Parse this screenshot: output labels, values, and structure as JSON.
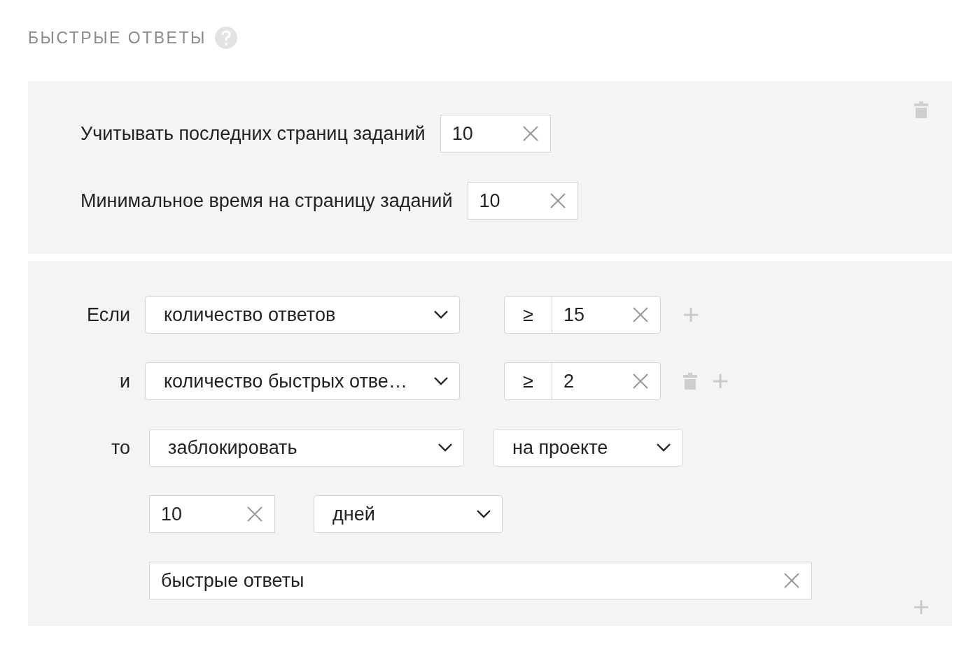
{
  "title": "БЫСТРЫЕ ОТВЕТЫ",
  "settings": [
    {
      "label": "Учитывать последних страниц заданий",
      "value": "10"
    },
    {
      "label": "Минимальное время на страницу заданий",
      "value": "10"
    }
  ],
  "conditions": [
    {
      "connector": "Если",
      "field": "количество ответов",
      "operator": "≥",
      "value": "15",
      "deletable": false
    },
    {
      "connector": "и",
      "field": "количество быстрых отве…",
      "operator": "≥",
      "value": "2",
      "deletable": true
    }
  ],
  "action": {
    "connector": "то",
    "action": "заблокировать",
    "scope": "на проекте",
    "duration": "10",
    "unit": "дней",
    "reason": "быстрые ответы"
  }
}
